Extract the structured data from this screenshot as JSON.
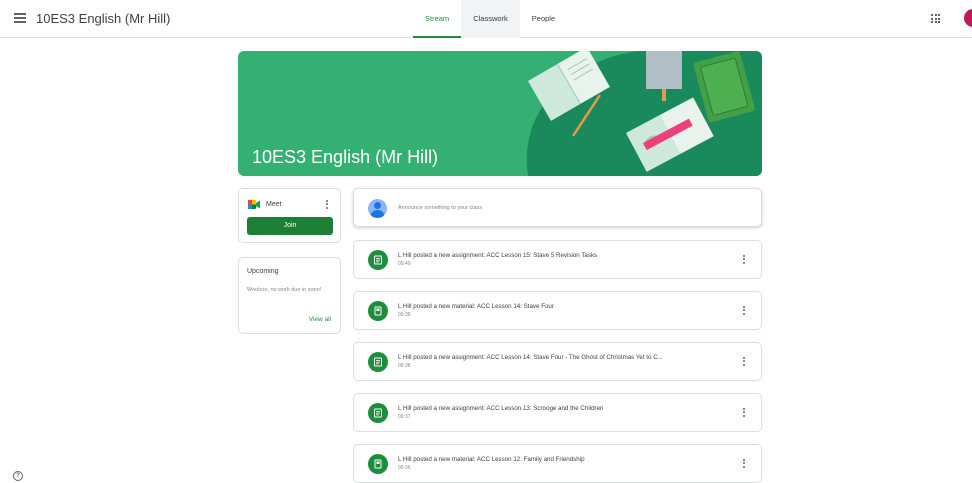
{
  "header": {
    "class_title": "10ES3 English (Mr Hill)",
    "tabs": [
      {
        "label": "Stream"
      },
      {
        "label": "Classwork"
      },
      {
        "label": "People"
      }
    ]
  },
  "banner": {
    "title": "10ES3 English (Mr Hill)"
  },
  "meet": {
    "label": "Meet",
    "join_label": "Join"
  },
  "upcoming": {
    "title": "Upcoming",
    "text": "Woohoo, no work due in soon!",
    "view_all": "View all"
  },
  "announce": {
    "placeholder": "Announce something to your class"
  },
  "posts": [
    {
      "icon": "assignment-icon",
      "text": "L Hill posted a new assignment: ACC Lesson 15: Stave 5 Revision Tasks",
      "time": "09:40"
    },
    {
      "icon": "material-icon",
      "text": "L Hill posted a new material: ACC Lesson 14: Stave Four",
      "time": "09:39"
    },
    {
      "icon": "assignment-icon",
      "text": "L Hill posted a new assignment: ACC Lesson 14: Stave Four - The Ghost of Christmas Yet to C...",
      "time": "09:38"
    },
    {
      "icon": "assignment-icon",
      "text": "L Hill posted a new assignment: ACC Lesson 13: Scrooge and the Children",
      "time": "09:37"
    },
    {
      "icon": "material-icon",
      "text": "L Hill posted a new material: ACC Lesson 12: Family and Friendship",
      "time": "09:36"
    }
  ],
  "colors": {
    "accent": "#1e8e3e",
    "banner": "#35b073",
    "banner_dark": "#1a8a5c"
  }
}
